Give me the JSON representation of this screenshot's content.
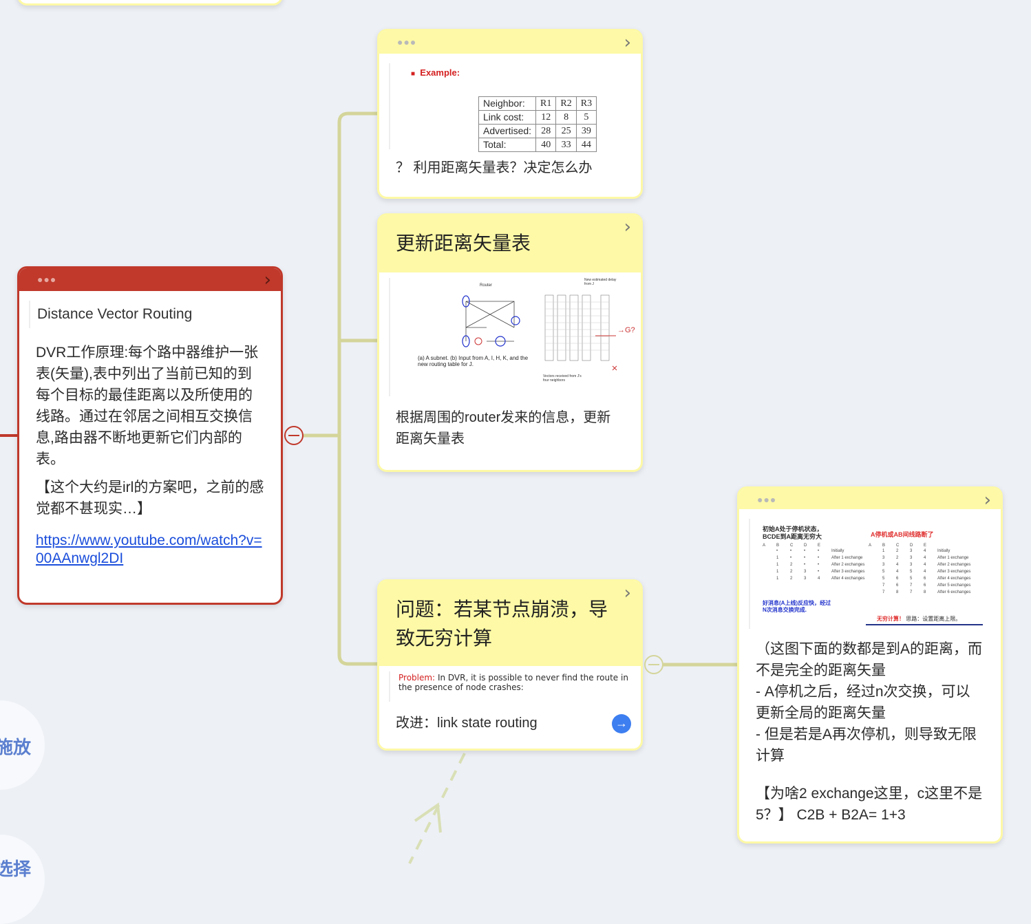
{
  "colors": {
    "connector": "#d4d59a",
    "red": "#c0392b",
    "yellow": "#fdf9a6",
    "link": "#1a4ddb",
    "arrow_button": "#3d7ef0"
  },
  "dvr_card": {
    "title": "Distance Vector Routing",
    "description": "DVR工作原理:每个路中器维护一张表(矢量),表中列出了当前已知的到每个目标的最佳距离以及所使用的线路。通过在邻居之间相互交换信息,路由器不断地更新它们内部的表。",
    "note": "【这个大约是irl的方案吧，之前的感觉都不甚现实…】",
    "link": "https://www.youtube.com/watch?v=00AAnwgl2DI"
  },
  "example_card": {
    "image": {
      "heading": "Example:",
      "table": {
        "headers": [
          "Neighbor:",
          "R1",
          "R2",
          "R3"
        ],
        "rows": [
          [
            "Link cost:",
            "12",
            "8",
            "5"
          ],
          [
            "Advertised:",
            "28",
            "25",
            "39"
          ],
          [
            "Total:",
            "40",
            "33",
            "44"
          ]
        ]
      }
    },
    "text": "？ 利用距离矢量表？决定怎么办"
  },
  "update_card": {
    "title": "更新距离矢量表",
    "image": {
      "caption": "(a) A subnet. (b) Input from A, I, H, K, and the new routing table for J.",
      "router_label": "Router",
      "vectors_label": "Vectors received from J's four neighbors",
      "new_table_label": "New estimated delay from J",
      "annotation": "→G?"
    },
    "text": "根据周围的router发来的信息，更新距离矢量表"
  },
  "problem_card": {
    "title": "问题：若某节点崩溃，导致无穷计算",
    "image": {
      "label": "Problem:",
      "text": "In DVR, it is possible to never find the route in the presence of node crashes:"
    },
    "text": "改进：link state routing"
  },
  "count_card": {
    "image": {
      "left_title": "初始A处于停机状态，BCDE到A距离无穷大",
      "right_title": "A停机或AB间线路断了",
      "left_note": "好消息(A上线)反应快，经过N次消息交换完成.",
      "right_note": "无穷计算！",
      "right_hint": "思路：设置距离上限。",
      "columns": [
        "A",
        "B",
        "C",
        "D",
        "E"
      ],
      "left_rows": [
        [
          "•",
          "•",
          "•",
          "•",
          "Initially"
        ],
        [
          "1",
          "•",
          "•",
          "•",
          "After 1 exchange"
        ],
        [
          "1",
          "2",
          "•",
          "•",
          "After 2 exchanges"
        ],
        [
          "1",
          "2",
          "3",
          "•",
          "After 3 exchanges"
        ],
        [
          "1",
          "2",
          "3",
          "4",
          "After 4 exchanges"
        ]
      ],
      "right_rows": [
        [
          "1",
          "2",
          "3",
          "4",
          "Initially"
        ],
        [
          "3",
          "2",
          "3",
          "4",
          "After 1 exchange"
        ],
        [
          "3",
          "4",
          "3",
          "4",
          "After 2 exchanges"
        ],
        [
          "5",
          "4",
          "5",
          "4",
          "After 3 exchanges"
        ],
        [
          "5",
          "6",
          "5",
          "6",
          "After 4 exchanges"
        ],
        [
          "7",
          "6",
          "7",
          "6",
          "After 5 exchanges"
        ],
        [
          "7",
          "8",
          "7",
          "8",
          "After 6 exchanges"
        ]
      ]
    },
    "text": "（这图下面的数都是到A的距离，而不是完全的距离矢量\n- A停机之后，经过n次交换，可以更新全局的距离矢量\n- 但是若是A再次停机，则导致无限计算",
    "question": "【为啥2 exchange这里，c这里不是5？】 C2B + B2A= 1+3"
  },
  "side_bubbles": [
    "施放",
    "选择"
  ]
}
